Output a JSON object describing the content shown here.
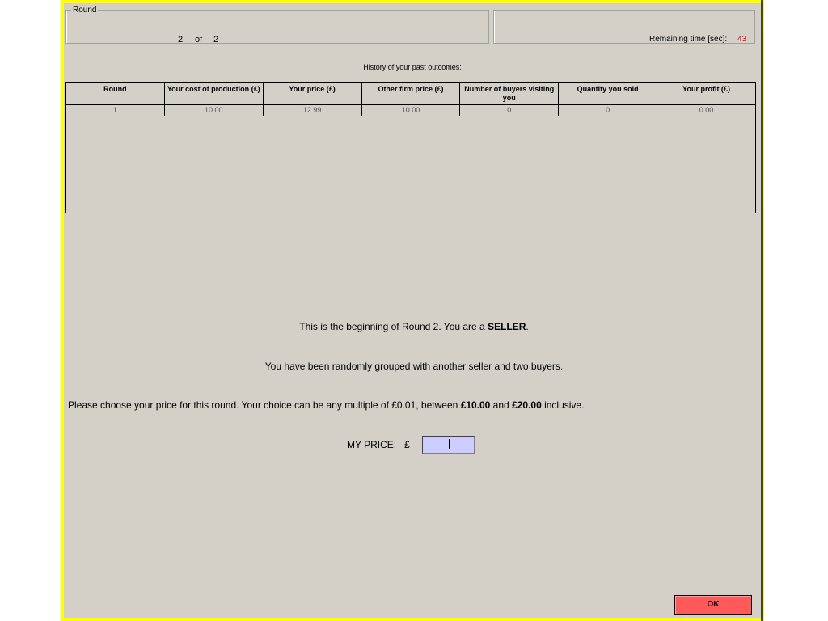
{
  "round_box": {
    "legend": "Round",
    "current": "2",
    "of_label": "of",
    "total": "2"
  },
  "timer": {
    "label": "Remaining time [sec]:",
    "value": "43",
    "value_color": "#ff0000"
  },
  "history": {
    "title": "History of your past outcomes:",
    "columns": [
      "Round",
      "Your cost of production (£)",
      "Your price (£)",
      "Other firm price (£)",
      "Number of buyers visiting you",
      "Quantity you sold",
      "Your profit (£)"
    ],
    "rows": [
      [
        "1",
        "10.00",
        "12.99",
        "10.00",
        "0",
        "0",
        "0.00"
      ]
    ]
  },
  "messages": {
    "intro_prefix": "This is the beginning of Round 2. You are a ",
    "intro_role": "SELLER",
    "intro_suffix": ".",
    "grouping": "You have been randomly grouped with another seller and two buyers.",
    "choose_prefix": "Please choose your price for this round. Your choice can be any multiple of £0.01, between ",
    "min_price": "£10.00",
    "choose_and": " and ",
    "max_price": "£20.00",
    "choose_suffix": " inclusive."
  },
  "price_input": {
    "label": "MY PRICE:",
    "currency": "£",
    "value": "",
    "background": "#ccccff"
  },
  "ok_button": {
    "label": "OK",
    "color": "#ff5a5a"
  },
  "colors": {
    "frame_border": "#ffff00",
    "panel_bg": "#d4d0c8"
  }
}
